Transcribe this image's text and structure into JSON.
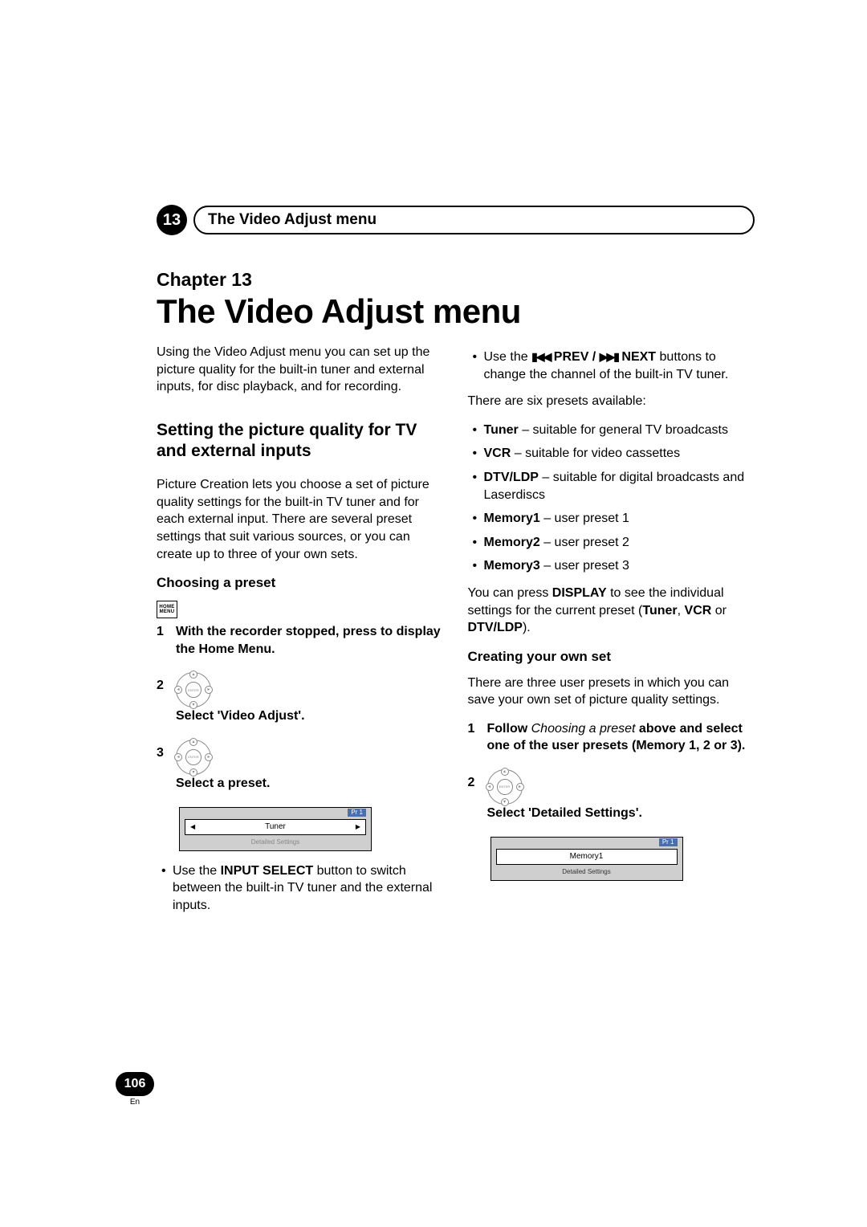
{
  "header": {
    "chapter_number": "13",
    "pill_title": "The Video Adjust menu"
  },
  "title": {
    "chapter_label": "Chapter 13",
    "main": "The Video Adjust menu"
  },
  "intro": "Using the Video Adjust menu you can set up the picture quality for the built-in tuner and external inputs, for disc playback, and for recording.",
  "left": {
    "section_heading": "Setting the picture quality for TV and external inputs",
    "paragraph": "Picture Creation lets you choose a set of picture quality settings for the built-in TV tuner and for each external input. There are several preset settings that suit various sources, or you can create up to three of your own sets.",
    "sub_heading": "Choosing a preset",
    "home_menu_icon": "HOME\nMENU",
    "step1": "With the recorder stopped, press to display the Home Menu.",
    "step2": "Select 'Video Adjust'.",
    "step3": "Select a preset.",
    "osd1": {
      "badge": "Pr 1",
      "row": "Tuner",
      "detail": "Detailed Settings"
    },
    "bullet_input_select_pre": "Use the ",
    "bullet_input_select_b": "INPUT SELECT",
    "bullet_input_select_post": " button to switch between the built-in TV tuner and the external inputs."
  },
  "right": {
    "bullet_prev_next_pre": "Use the ",
    "bullet_prev_next_label": " PREV /  NEXT",
    "bullet_prev_next_post": " buttons to change the channel of the built-in TV tuner.",
    "presets_intro": "There are six presets available:",
    "presets": [
      {
        "b": "Tuner",
        "t": " – suitable for general TV broadcasts"
      },
      {
        "b": "VCR",
        "t": " – suitable for video cassettes"
      },
      {
        "b": "DTV/LDP",
        "t": " – suitable for digital broadcasts and Laserdiscs"
      },
      {
        "b": "Memory1",
        "t": " – user preset 1"
      },
      {
        "b": "Memory2",
        "t": " – user preset 2"
      },
      {
        "b": "Memory3",
        "t": " – user preset 3"
      }
    ],
    "display_para_1": "You can press ",
    "display_para_b1": "DISPLAY",
    "display_para_2": " to see the individual settings for the current preset (",
    "display_para_b2": "Tuner",
    "display_para_3": ", ",
    "display_para_b3": "VCR",
    "display_para_4": " or ",
    "display_para_b4": "DTV/LDP",
    "display_para_5": ").",
    "creating_heading": "Creating your own set",
    "creating_para": "There are three user presets in which you can save your own set of picture quality settings.",
    "step1_pre": "Follow ",
    "step1_ital": "Choosing a preset",
    "step1_post": " above and select one of the user presets (Memory 1, 2 or 3).",
    "step2": "Select 'Detailed Settings'.",
    "osd2": {
      "badge": "Pr 1",
      "row": "Memory1",
      "detail": "Detailed Settings"
    }
  },
  "footer": {
    "page": "106",
    "lang": "En"
  }
}
